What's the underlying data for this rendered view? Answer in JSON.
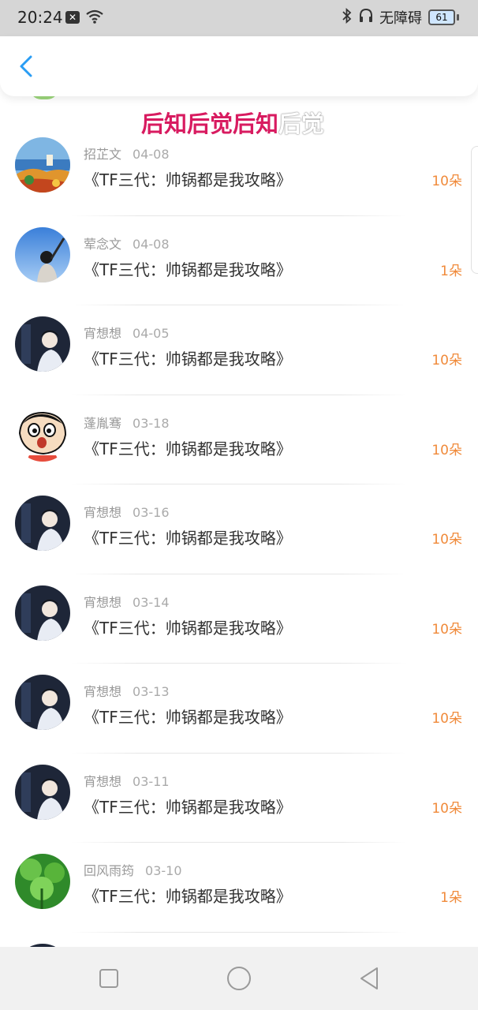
{
  "status_bar": {
    "time": "20:24",
    "notification_glyph": "✕",
    "network_label": "无障碍",
    "battery_level": "61",
    "icons": [
      "x-notification-icon",
      "wifi-icon",
      "bluetooth-icon",
      "headphones-icon",
      "battery-icon"
    ]
  },
  "header": {
    "back_icon": "chevron-left-icon",
    "accent_color": "#2a9df4"
  },
  "overlay": {
    "text_pink": "后知后觉后知",
    "text_white": "后觉"
  },
  "records": [
    {
      "user": "招芷文",
      "date": "04-08",
      "book": "《TF三代：帅锅都是我攻略》",
      "amount": "10朵",
      "avatar": "landscape-painting"
    },
    {
      "user": "荤念文",
      "date": "04-08",
      "book": "《TF三代：帅锅都是我攻略》",
      "amount": "1朵",
      "avatar": "sky-girl"
    },
    {
      "user": "宵想想",
      "date": "04-05",
      "book": "《TF三代：帅锅都是我攻略》",
      "amount": "10朵",
      "avatar": "dark-portrait"
    },
    {
      "user": "蓬胤骞",
      "date": "03-18",
      "book": "《TF三代：帅锅都是我攻略》",
      "amount": "10朵",
      "avatar": "cartoon-kid"
    },
    {
      "user": "宵想想",
      "date": "03-16",
      "book": "《TF三代：帅锅都是我攻略》",
      "amount": "10朵",
      "avatar": "dark-portrait"
    },
    {
      "user": "宵想想",
      "date": "03-14",
      "book": "《TF三代：帅锅都是我攻略》",
      "amount": "10朵",
      "avatar": "dark-portrait"
    },
    {
      "user": "宵想想",
      "date": "03-13",
      "book": "《TF三代：帅锅都是我攻略》",
      "amount": "10朵",
      "avatar": "dark-portrait"
    },
    {
      "user": "宵想想",
      "date": "03-11",
      "book": "《TF三代：帅锅都是我攻略》",
      "amount": "10朵",
      "avatar": "dark-portrait"
    },
    {
      "user": "回风雨筠",
      "date": "03-10",
      "book": "《TF三代：帅锅都是我攻略》",
      "amount": "1朵",
      "avatar": "green-leaf"
    }
  ],
  "nav_bar": {
    "buttons": [
      "square-recent-icon",
      "circle-home-icon",
      "triangle-back-icon"
    ]
  },
  "colors": {
    "amount": "#f08a3a",
    "overlay_pink": "#d81b60",
    "status_bar_bg": "#d6d6d6",
    "nav_bar_bg": "#f1f1f1"
  }
}
